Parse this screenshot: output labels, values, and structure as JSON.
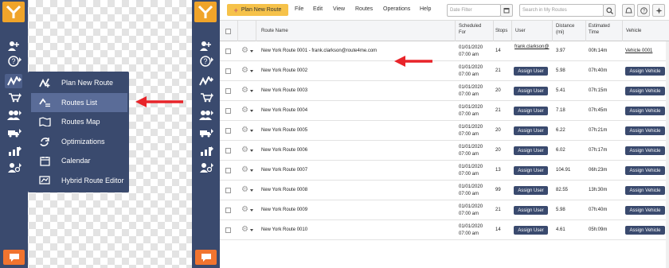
{
  "left_panel": {
    "flyout_items": [
      {
        "label": "Plan New Route",
        "icon": "plan-route-icon"
      },
      {
        "label": "Routes List",
        "icon": "routes-list-icon",
        "active": true
      },
      {
        "label": "Routes Map",
        "icon": "map-icon"
      },
      {
        "label": "Optimizations",
        "icon": "optimizations-icon"
      },
      {
        "label": "Calendar",
        "icon": "calendar-icon"
      },
      {
        "label": "Hybrid Route Editor",
        "icon": "hybrid-editor-icon"
      }
    ]
  },
  "toolbar": {
    "plan_button": "Plan New Route",
    "menu": [
      "File",
      "Edit",
      "View",
      "Routes",
      "Operations",
      "Help"
    ],
    "date_filter_placeholder": "Date Filter",
    "search_placeholder": "Search in My Routes"
  },
  "table": {
    "headers": {
      "route_name": "Route Name",
      "scheduled_1": "Scheduled",
      "scheduled_2": "For",
      "stops": "Stops",
      "user": "User",
      "distance_1": "Distance",
      "distance_2": "(mi)",
      "time_1": "Estimated",
      "time_2": "Time",
      "vehicle": "Vehicle"
    },
    "rows": [
      {
        "name": "New York Route 0001 - frank.clarkson@route4me.com",
        "date": "01/01/2020",
        "time": "07:00 am",
        "stops": "14",
        "user": "frank.clarkson@",
        "distance": "3.97",
        "est_time": "00h:14m",
        "vehicle": "Vehicle 0001"
      },
      {
        "name": "New York Route 0002",
        "date": "01/01/2020",
        "time": "07:00 am",
        "stops": "21",
        "user": "Assign User",
        "distance": "5.98",
        "est_time": "07h:40m",
        "vehicle": "Assign Vehicle"
      },
      {
        "name": "New York Route 0003",
        "date": "01/01/2020",
        "time": "07:00 am",
        "stops": "20",
        "user": "Assign User",
        "distance": "5.41",
        "est_time": "07h:15m",
        "vehicle": "Assign Vehicle"
      },
      {
        "name": "New York Route 0004",
        "date": "01/01/2020",
        "time": "07:00 am",
        "stops": "21",
        "user": "Assign User",
        "distance": "7.18",
        "est_time": "07h:45m",
        "vehicle": "Assign Vehicle"
      },
      {
        "name": "New York Route 0005",
        "date": "01/01/2020",
        "time": "07:00 am",
        "stops": "20",
        "user": "Assign User",
        "distance": "6.22",
        "est_time": "07h:21m",
        "vehicle": "Assign Vehicle"
      },
      {
        "name": "New York Route 0006",
        "date": "01/01/2020",
        "time": "07:00 am",
        "stops": "20",
        "user": "Assign User",
        "distance": "6.02",
        "est_time": "07h:17m",
        "vehicle": "Assign Vehicle"
      },
      {
        "name": "New York Route 0007",
        "date": "01/01/2020",
        "time": "07:00 am",
        "stops": "13",
        "user": "Assign User",
        "distance": "104.91",
        "est_time": "06h:23m",
        "vehicle": "Assign Vehicle"
      },
      {
        "name": "New York Route 0008",
        "date": "01/01/2020",
        "time": "07:00 am",
        "stops": "99",
        "user": "Assign User",
        "distance": "82.55",
        "est_time": "13h:30m",
        "vehicle": "Assign Vehicle"
      },
      {
        "name": "New York Route 0009",
        "date": "01/01/2020",
        "time": "07:00 am",
        "stops": "21",
        "user": "Assign User",
        "distance": "5.98",
        "est_time": "07h:40m",
        "vehicle": "Assign Vehicle"
      },
      {
        "name": "New York Route 0010",
        "date": "01/01/2020",
        "time": "07:00 am",
        "stops": "14",
        "user": "Assign User",
        "distance": "4.61",
        "est_time": "05h:09m",
        "vehicle": "Assign Vehicle"
      }
    ]
  },
  "colors": {
    "accent": "#f6c24a",
    "sidebar": "#3a4a6e",
    "arrow": "#e8242a",
    "chat": "#f1742f"
  }
}
